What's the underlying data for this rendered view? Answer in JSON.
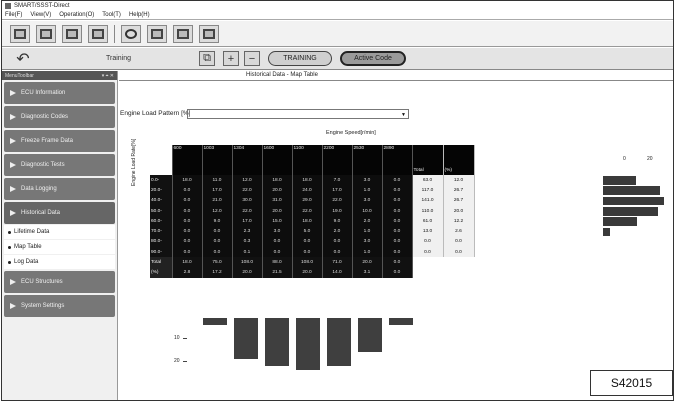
{
  "app": {
    "title": "SMART/SSST-Direct",
    "menu": [
      "File(F)",
      "View(V)",
      "Operation(O)",
      "Tool(T)",
      "Help(H)"
    ]
  },
  "subtoolbar": {
    "mode_label": "Training",
    "training_button": "TRAINING",
    "active_code_button": "Active Code"
  },
  "sidebar": {
    "header": "MenuToolbar",
    "header_controls": "▾ ⌖ ✕",
    "items_top": [
      "ECU Information",
      "Diagnostic Codes",
      "Freeze Frame Data",
      "Diagnostic Tests",
      "Data Logging",
      "Historical Data"
    ],
    "sub_items": [
      "Lifetime Data",
      "Map Table",
      "Log Data"
    ],
    "items_bottom": [
      "ECU Structures",
      "System Settings"
    ]
  },
  "main": {
    "tab_title": "Historical Data - Map Table",
    "pattern_label": "Engine Load Pattern [%]",
    "pattern_value": "",
    "speed_axis_title": "Engine Speed[r/min]",
    "load_axis_title": "Engine Load Rate[%]",
    "col_headers": [
      "600",
      "1003",
      "1304",
      "1600",
      "1100",
      "2200",
      "2530",
      "2890"
    ],
    "total_header": "Total",
    "pct_header": "(%)",
    "rows": [
      {
        "label": "0.0-",
        "cells": [
          "18.0",
          "11.0",
          "12.0",
          "18.0",
          "18.0",
          "7.0",
          "3.0",
          "0.0"
        ],
        "total": "63.0",
        "pct": "12.0"
      },
      {
        "label": "20.0-",
        "cells": [
          "0.0",
          "17.0",
          "22.0",
          "20.0",
          "24.0",
          "17.0",
          "1.0",
          "0.0"
        ],
        "total": "117.0",
        "pct": "26.7"
      },
      {
        "label": "40.0-",
        "cells": [
          "0.0",
          "21.0",
          "30.0",
          "31.0",
          "29.0",
          "22.0",
          "3.0",
          "0.0"
        ],
        "total": "141.0",
        "pct": "26.7"
      },
      {
        "label": "50.0-",
        "cells": [
          "0.0",
          "12.0",
          "22.0",
          "20.0",
          "22.0",
          "19.0",
          "10.0",
          "0.0"
        ],
        "total": "110.0",
        "pct": "20.0"
      },
      {
        "label": "60.0-",
        "cells": [
          "0.0",
          "9.0",
          "17.0",
          "15.0",
          "18.0",
          "9.0",
          "2.0",
          "0.0"
        ],
        "total": "61.0",
        "pct": "12.2"
      },
      {
        "label": "70.0-",
        "cells": [
          "0.0",
          "0.0",
          "2.3",
          "3.0",
          "5.0",
          "2.0",
          "1.0",
          "0.0"
        ],
        "total": "13.0",
        "pct": "2.6"
      },
      {
        "label": "80.0-",
        "cells": [
          "0.0",
          "0.0",
          "0.3",
          "0.0",
          "0.0",
          "0.0",
          "3.0",
          "0.0"
        ],
        "total": "0.0",
        "pct": "0.0"
      },
      {
        "label": "90.0-",
        "cells": [
          "0.0",
          "0.0",
          "0.1",
          "0.0",
          "0.0",
          "0.0",
          "1.0",
          "0.0"
        ],
        "total": "0.0",
        "pct": "0.0"
      }
    ],
    "total_row": {
      "label": "Total",
      "cells": [
        "18.0",
        "75.0",
        "108.0",
        "88.0",
        "108.0",
        "71.0",
        "20.0",
        "0.0"
      ]
    },
    "pct_row": {
      "label": "(%)",
      "cells": [
        "2.8",
        "17.2",
        "20.0",
        "21.5",
        "20.0",
        "14.0",
        "3.1",
        "0.0"
      ]
    },
    "row_chart_tick_0": "0",
    "row_chart_tick_20": "20",
    "col_chart_ticks": [
      "10",
      "20"
    ],
    "row_chart_values": [
      12.0,
      20.7,
      22.0,
      20.0,
      12.2,
      2.6,
      0.0,
      0.0
    ],
    "col_chart_values": [
      2.8,
      17.2,
      20.0,
      21.5,
      20.0,
      14.0,
      3.1,
      0.0
    ]
  },
  "figure_code": "S42015"
}
